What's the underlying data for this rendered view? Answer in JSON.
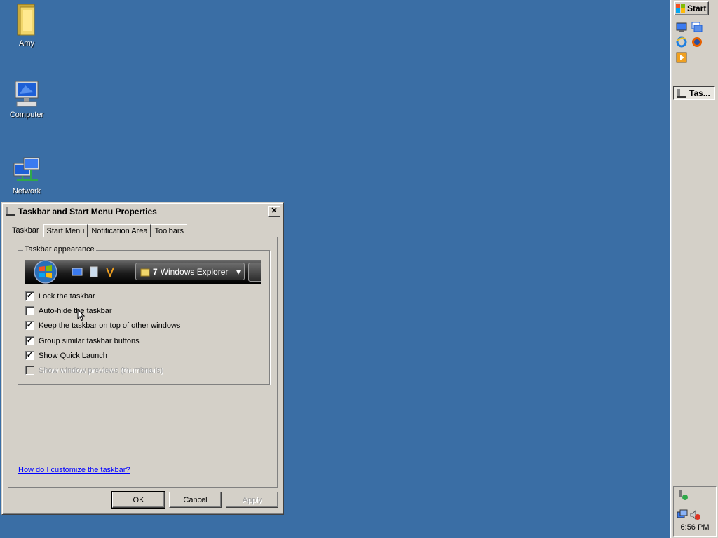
{
  "desktop": {
    "icons": [
      {
        "label": "Amy",
        "icon": "user-folder-icon"
      },
      {
        "label": "Computer",
        "icon": "computer-icon"
      },
      {
        "label": "Network",
        "icon": "network-icon"
      }
    ]
  },
  "taskbar": {
    "start_label": "Start",
    "quick_launch": [
      "show-desktop-icon",
      "switch-windows-icon",
      "internet-explorer-icon",
      "firefox-icon",
      "media-player-icon"
    ],
    "task_button_label": "Tas...",
    "clock": "6:56 PM"
  },
  "dialog": {
    "title": "Taskbar and Start Menu Properties",
    "close_glyph": "✕",
    "tabs": [
      "Taskbar",
      "Start Menu",
      "Notification Area",
      "Toolbars"
    ],
    "active_tab": "Taskbar",
    "group_label": "Taskbar appearance",
    "preview": {
      "button_count": "7",
      "button_label": "Windows Explorer",
      "dropdown_glyph": "▾"
    },
    "options": [
      {
        "label": "Lock the taskbar",
        "checked": true,
        "enabled": true
      },
      {
        "label": "Auto-hide the taskbar",
        "checked": false,
        "enabled": true
      },
      {
        "label": "Keep the taskbar on top of other windows",
        "checked": true,
        "enabled": true
      },
      {
        "label": "Group similar taskbar buttons",
        "checked": true,
        "enabled": true
      },
      {
        "label": "Show Quick Launch",
        "checked": true,
        "enabled": true
      },
      {
        "label": "Show window previews (thumbnails)",
        "checked": false,
        "enabled": false
      }
    ],
    "help_link": "How do I customize the taskbar?",
    "buttons": {
      "ok": "OK",
      "cancel": "Cancel",
      "apply": "Apply"
    }
  },
  "colors": {
    "desktop": "#3a6ea5",
    "face": "#d4d0c8",
    "link": "#0000ff"
  }
}
